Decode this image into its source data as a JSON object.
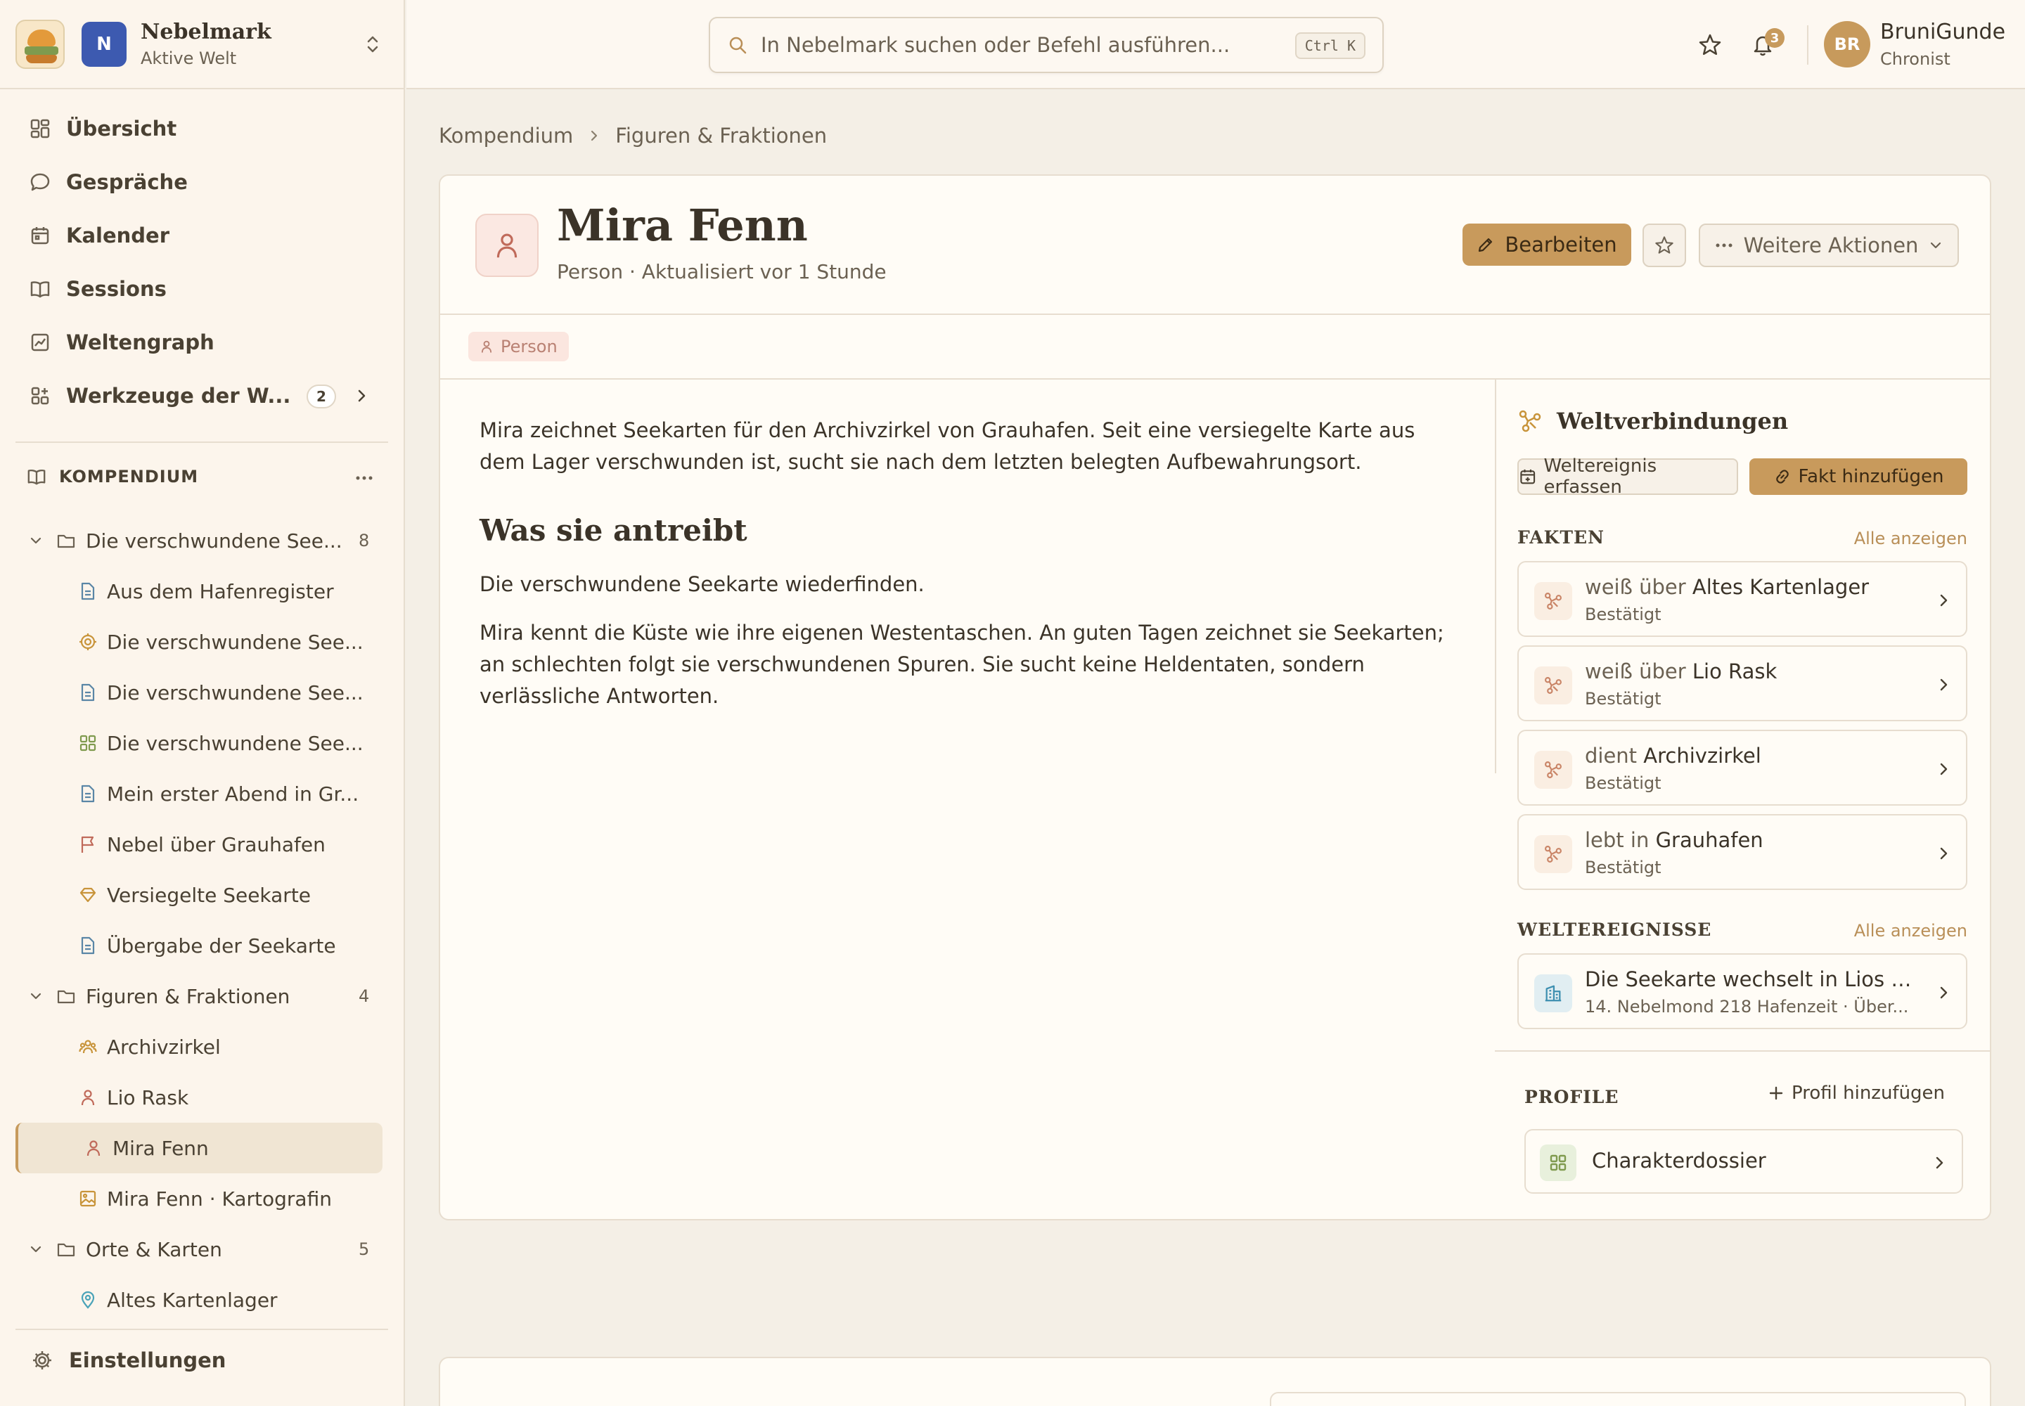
{
  "workspace": {
    "name": "Nebelmark",
    "status": "Aktive Welt",
    "initial": "N"
  },
  "nav": [
    {
      "label": "Übersicht",
      "icon": "dashboard-icon"
    },
    {
      "label": "Gespräche",
      "icon": "chat-icon"
    },
    {
      "label": "Kalender",
      "icon": "calendar-icon"
    },
    {
      "label": "Sessions",
      "icon": "book-icon"
    },
    {
      "label": "Weltengraph",
      "icon": "graph-icon"
    },
    {
      "label": "Werkzeuge der W...",
      "icon": "tools-icon",
      "count": "2"
    }
  ],
  "compendium": {
    "heading": "KOMPENDIUM",
    "folders": [
      {
        "label": "Die verschwundene See...",
        "count": "8",
        "items": [
          {
            "label": "Aus dem Hafenregister",
            "icon": "document-icon",
            "color": "#5a86a6"
          },
          {
            "label": "Die verschwundene See...",
            "icon": "target-icon",
            "color": "#c8943a"
          },
          {
            "label": "Die verschwundene See...",
            "icon": "document-icon",
            "color": "#5a86a6"
          },
          {
            "label": "Die verschwundene See...",
            "icon": "grid-icon",
            "color": "#7f9a4e"
          },
          {
            "label": "Mein erster Abend in Gr...",
            "icon": "document-icon",
            "color": "#5a86a6"
          },
          {
            "label": "Nebel über Grauhafen",
            "icon": "flag-icon",
            "color": "#c06a5a"
          },
          {
            "label": "Versiegelte Seekarte",
            "icon": "gem-icon",
            "color": "#c8943a"
          },
          {
            "label": "Übergabe der Seekarte",
            "icon": "document-icon",
            "color": "#5a86a6"
          }
        ]
      },
      {
        "label": "Figuren & Fraktionen",
        "count": "4",
        "items": [
          {
            "label": "Archivzirkel",
            "icon": "group-icon",
            "color": "#c8943a"
          },
          {
            "label": "Lio Rask",
            "icon": "person-icon",
            "color": "#c06a5a"
          },
          {
            "label": "Mira Fenn",
            "icon": "person-icon",
            "color": "#c06a5a",
            "active": true
          },
          {
            "label": "Mira Fenn · Kartografin",
            "icon": "image-icon",
            "color": "#c8943a"
          }
        ]
      },
      {
        "label": "Orte & Karten",
        "count": "5",
        "items": [
          {
            "label": "Altes Kartenlager",
            "icon": "pin-icon",
            "color": "#4aa3b8"
          }
        ]
      }
    ]
  },
  "settings_label": "Einstellungen",
  "search": {
    "placeholder": "In Nebelmark suchen oder Befehl ausführen...",
    "shortcut": "Ctrl K"
  },
  "notifications": {
    "count": "3"
  },
  "user": {
    "initials": "BR",
    "name": "BruniGunde",
    "role": "Chronist"
  },
  "breadcrumb": [
    "Kompendium",
    "Figuren & Fraktionen"
  ],
  "entity": {
    "title": "Mira Fenn",
    "subtitle": "Person · Aktualisiert vor 1 Stunde",
    "edit_label": "Bearbeiten",
    "more_label": "Weitere Aktionen",
    "tag": "Person",
    "intro": "Mira zeichnet Seekarten für den Archivzirkel von Grauhafen. Seit eine versiegelte Karte aus dem Lager verschwunden ist, sucht sie nach dem letzten belegten Aufbewahrungsort.",
    "heading": "Was sie antreibt",
    "drive": "Die verschwundene Seekarte wiederfinden.",
    "description": "Mira kennt die Küste wie ihre eigenen Westentaschen. An guten Tagen zeichnet sie Seekarten; an schlechten folgt sie verschwundenen Spuren. Sie sucht keine Heldentaten, sondern verlässliche Antworten."
  },
  "connections": {
    "title": "Weltverbindungen",
    "event_button": "Weltereignis erfassen",
    "fact_button": "Fakt hinzufügen",
    "facts_label": "FAKTEN",
    "show_all": "Alle anzeigen",
    "facts": [
      {
        "relation": "weiß über",
        "target": "Altes Kartenlager",
        "status": "Bestätigt"
      },
      {
        "relation": "weiß über",
        "target": "Lio Rask",
        "status": "Bestätigt"
      },
      {
        "relation": "dient",
        "target": "Archivzirkel",
        "status": "Bestätigt"
      },
      {
        "relation": "lebt in",
        "target": "Grauhafen",
        "status": "Bestätigt"
      }
    ],
    "events_label": "WELTEREIGNISSE",
    "events": [
      {
        "title": "Die Seekarte wechselt in Lios O...",
        "meta": "14. Nebelmond 218 Hafenzeit · Über..."
      }
    ]
  },
  "profiles": {
    "label": "PROFILE",
    "add_label": "Profil hinzufügen",
    "items": [
      {
        "name": "Charakterdossier"
      }
    ]
  }
}
